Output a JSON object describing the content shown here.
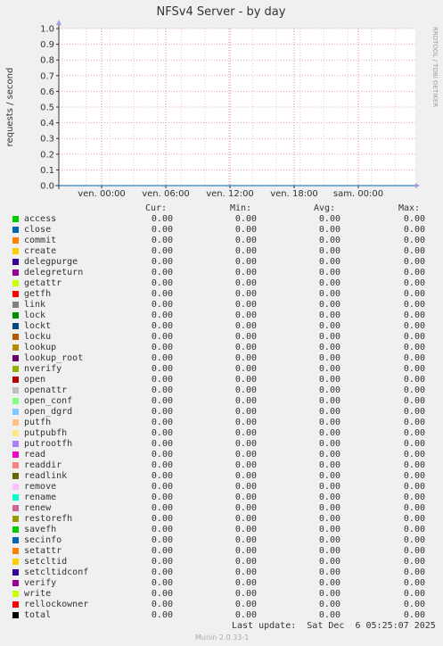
{
  "chart_data": {
    "type": "line",
    "title": "NFSv4 Server - by day",
    "ylabel": "requests / second",
    "ylim": [
      0,
      1.0
    ],
    "y_ticks": [
      "0.0",
      "0.1",
      "0.2",
      "0.3",
      "0.4",
      "0.5",
      "0.6",
      "0.7",
      "0.8",
      "0.9",
      "1.0"
    ],
    "x_ticks": [
      "ven. 00:00",
      "ven. 06:00",
      "ven. 12:00",
      "ven. 18:00",
      "sam. 00:00"
    ],
    "series_values": "all series are 0.00",
    "grid": true
  },
  "vendor": "RRDTOOL / TOBI OETIKER",
  "headers": {
    "cur": "Cur:",
    "min": "Min:",
    "avg": "Avg:",
    "max": "Max:"
  },
  "legend": [
    {
      "name": "access",
      "color": "#00cc00",
      "cur": "0.00",
      "min": "0.00",
      "avg": "0.00",
      "max": "0.00"
    },
    {
      "name": "close",
      "color": "#0066b3",
      "cur": "0.00",
      "min": "0.00",
      "avg": "0.00",
      "max": "0.00"
    },
    {
      "name": "commit",
      "color": "#ff8000",
      "cur": "0.00",
      "min": "0.00",
      "avg": "0.00",
      "max": "0.00"
    },
    {
      "name": "create",
      "color": "#ffcc00",
      "cur": "0.00",
      "min": "0.00",
      "avg": "0.00",
      "max": "0.00"
    },
    {
      "name": "delegpurge",
      "color": "#330099",
      "cur": "0.00",
      "min": "0.00",
      "avg": "0.00",
      "max": "0.00"
    },
    {
      "name": "delegreturn",
      "color": "#990099",
      "cur": "0.00",
      "min": "0.00",
      "avg": "0.00",
      "max": "0.00"
    },
    {
      "name": "getattr",
      "color": "#ccff00",
      "cur": "0.00",
      "min": "0.00",
      "avg": "0.00",
      "max": "0.00"
    },
    {
      "name": "getfh",
      "color": "#ff0000",
      "cur": "0.00",
      "min": "0.00",
      "avg": "0.00",
      "max": "0.00"
    },
    {
      "name": "link",
      "color": "#808080",
      "cur": "0.00",
      "min": "0.00",
      "avg": "0.00",
      "max": "0.00"
    },
    {
      "name": "lock",
      "color": "#008f00",
      "cur": "0.00",
      "min": "0.00",
      "avg": "0.00",
      "max": "0.00"
    },
    {
      "name": "lockt",
      "color": "#00487d",
      "cur": "0.00",
      "min": "0.00",
      "avg": "0.00",
      "max": "0.00"
    },
    {
      "name": "locku",
      "color": "#b35a00",
      "cur": "0.00",
      "min": "0.00",
      "avg": "0.00",
      "max": "0.00"
    },
    {
      "name": "lookup",
      "color": "#b38f00",
      "cur": "0.00",
      "min": "0.00",
      "avg": "0.00",
      "max": "0.00"
    },
    {
      "name": "lookup_root",
      "color": "#6b006b",
      "cur": "0.00",
      "min": "0.00",
      "avg": "0.00",
      "max": "0.00"
    },
    {
      "name": "nverify",
      "color": "#8fb300",
      "cur": "0.00",
      "min": "0.00",
      "avg": "0.00",
      "max": "0.00"
    },
    {
      "name": "open",
      "color": "#b30000",
      "cur": "0.00",
      "min": "0.00",
      "avg": "0.00",
      "max": "0.00"
    },
    {
      "name": "openattr",
      "color": "#bebebe",
      "cur": "0.00",
      "min": "0.00",
      "avg": "0.00",
      "max": "0.00"
    },
    {
      "name": "open_conf",
      "color": "#80ff80",
      "cur": "0.00",
      "min": "0.00",
      "avg": "0.00",
      "max": "0.00"
    },
    {
      "name": "open_dgrd",
      "color": "#80c9ff",
      "cur": "0.00",
      "min": "0.00",
      "avg": "0.00",
      "max": "0.00"
    },
    {
      "name": "putfh",
      "color": "#ffc080",
      "cur": "0.00",
      "min": "0.00",
      "avg": "0.00",
      "max": "0.00"
    },
    {
      "name": "putpubfh",
      "color": "#ffe680",
      "cur": "0.00",
      "min": "0.00",
      "avg": "0.00",
      "max": "0.00"
    },
    {
      "name": "putrootfh",
      "color": "#aa80ff",
      "cur": "0.00",
      "min": "0.00",
      "avg": "0.00",
      "max": "0.00"
    },
    {
      "name": "read",
      "color": "#ee00cc",
      "cur": "0.00",
      "min": "0.00",
      "avg": "0.00",
      "max": "0.00"
    },
    {
      "name": "readdir",
      "color": "#ff8080",
      "cur": "0.00",
      "min": "0.00",
      "avg": "0.00",
      "max": "0.00"
    },
    {
      "name": "readlink",
      "color": "#666600",
      "cur": "0.00",
      "min": "0.00",
      "avg": "0.00",
      "max": "0.00"
    },
    {
      "name": "remove",
      "color": "#ffbfff",
      "cur": "0.00",
      "min": "0.00",
      "avg": "0.00",
      "max": "0.00"
    },
    {
      "name": "rename",
      "color": "#00ffcc",
      "cur": "0.00",
      "min": "0.00",
      "avg": "0.00",
      "max": "0.00"
    },
    {
      "name": "renew",
      "color": "#cc6699",
      "cur": "0.00",
      "min": "0.00",
      "avg": "0.00",
      "max": "0.00"
    },
    {
      "name": "restorefh",
      "color": "#999900",
      "cur": "0.00",
      "min": "0.00",
      "avg": "0.00",
      "max": "0.00"
    },
    {
      "name": "savefh",
      "color": "#00cc00",
      "cur": "0.00",
      "min": "0.00",
      "avg": "0.00",
      "max": "0.00"
    },
    {
      "name": "secinfo",
      "color": "#0066b3",
      "cur": "0.00",
      "min": "0.00",
      "avg": "0.00",
      "max": "0.00"
    },
    {
      "name": "setattr",
      "color": "#ff8000",
      "cur": "0.00",
      "min": "0.00",
      "avg": "0.00",
      "max": "0.00"
    },
    {
      "name": "setcltid",
      "color": "#ffcc00",
      "cur": "0.00",
      "min": "0.00",
      "avg": "0.00",
      "max": "0.00"
    },
    {
      "name": "setcltidconf",
      "color": "#330099",
      "cur": "0.00",
      "min": "0.00",
      "avg": "0.00",
      "max": "0.00"
    },
    {
      "name": "verify",
      "color": "#990099",
      "cur": "0.00",
      "min": "0.00",
      "avg": "0.00",
      "max": "0.00"
    },
    {
      "name": "write",
      "color": "#ccff00",
      "cur": "0.00",
      "min": "0.00",
      "avg": "0.00",
      "max": "0.00"
    },
    {
      "name": "rellockowner",
      "color": "#ff0000",
      "cur": "0.00",
      "min": "0.00",
      "avg": "0.00",
      "max": "0.00"
    },
    {
      "name": "total",
      "color": "#000000",
      "cur": "0.00",
      "min": "0.00",
      "avg": "0.00",
      "max": "0.00"
    }
  ],
  "last_update": "Last update:  Sat Dec  6 05:25:07 2025",
  "munin_version": "Munin 2.0.33-1"
}
